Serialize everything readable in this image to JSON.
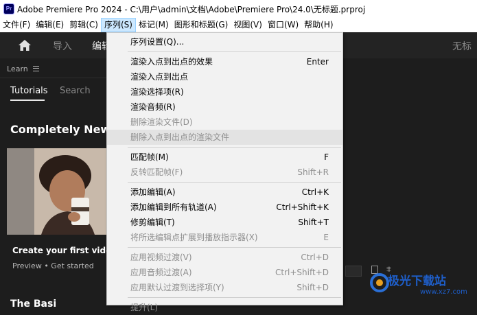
{
  "window": {
    "app_icon": "Pr",
    "title": "Adobe Premiere Pro 2024 - C:\\用户\\admin\\文档\\Adobe\\Premiere Pro\\24.0\\无标题.prproj"
  },
  "menubar": [
    {
      "label": "文件(F)"
    },
    {
      "label": "编辑(E)"
    },
    {
      "label": "剪辑(C)"
    },
    {
      "label": "序列(S)",
      "active": true
    },
    {
      "label": "标记(M)"
    },
    {
      "label": "图形和标题(G)"
    },
    {
      "label": "视图(V)"
    },
    {
      "label": "窗口(W)"
    },
    {
      "label": "帮助(H)"
    }
  ],
  "header": {
    "home_icon": "home-icon",
    "tabs": [
      "导入",
      "编辑"
    ],
    "right_text": "无标"
  },
  "learn_panel": {
    "panel_label": "Learn",
    "menu_icon": "hamburger-icon",
    "tabs": [
      "Tutorials",
      "Search"
    ],
    "headline": "Completely New? S",
    "card_title": "Create your first video",
    "card_meta": "Preview • Get started",
    "bottom_heading": "The Basi"
  },
  "sequence_menu": {
    "items": [
      {
        "label": "序列设置(Q)...",
        "shortcut": "",
        "disabled": false
      },
      {
        "separator": true
      },
      {
        "label": "渲染入点到出点的效果",
        "shortcut": "Enter",
        "disabled": false
      },
      {
        "label": "渲染入点到出点",
        "shortcut": "",
        "disabled": false
      },
      {
        "label": "渲染选择项(R)",
        "shortcut": "",
        "disabled": false
      },
      {
        "label": "渲染音频(R)",
        "shortcut": "",
        "disabled": false
      },
      {
        "label": "删除渲染文件(D)",
        "shortcut": "",
        "disabled": true
      },
      {
        "label": "删除入点到出点的渲染文件",
        "shortcut": "",
        "disabled": true,
        "hover": true
      },
      {
        "separator": true
      },
      {
        "label": "匹配帧(M)",
        "shortcut": "F",
        "disabled": false
      },
      {
        "label": "反转匹配帧(F)",
        "shortcut": "Shift+R",
        "disabled": true
      },
      {
        "separator": true
      },
      {
        "label": "添加编辑(A)",
        "shortcut": "Ctrl+K",
        "disabled": false
      },
      {
        "label": "添加编辑到所有轨道(A)",
        "shortcut": "Ctrl+Shift+K",
        "disabled": false
      },
      {
        "label": "修剪编辑(T)",
        "shortcut": "Shift+T",
        "disabled": false
      },
      {
        "label": "将所选编辑点扩展到播放指示器(X)",
        "shortcut": "E",
        "disabled": true
      },
      {
        "separator": true
      },
      {
        "label": "应用视频过渡(V)",
        "shortcut": "Ctrl+D",
        "disabled": true
      },
      {
        "label": "应用音频过渡(A)",
        "shortcut": "Ctrl+Shift+D",
        "disabled": true
      },
      {
        "label": "应用默认过渡到选择项(Y)",
        "shortcut": "Shift+D",
        "disabled": true
      },
      {
        "separator": true
      },
      {
        "label": "提升(L)",
        "shortcut": "",
        "disabled": true
      }
    ]
  },
  "watermark": {
    "main": "极光下载站",
    "sub": "www.xz7.com"
  }
}
